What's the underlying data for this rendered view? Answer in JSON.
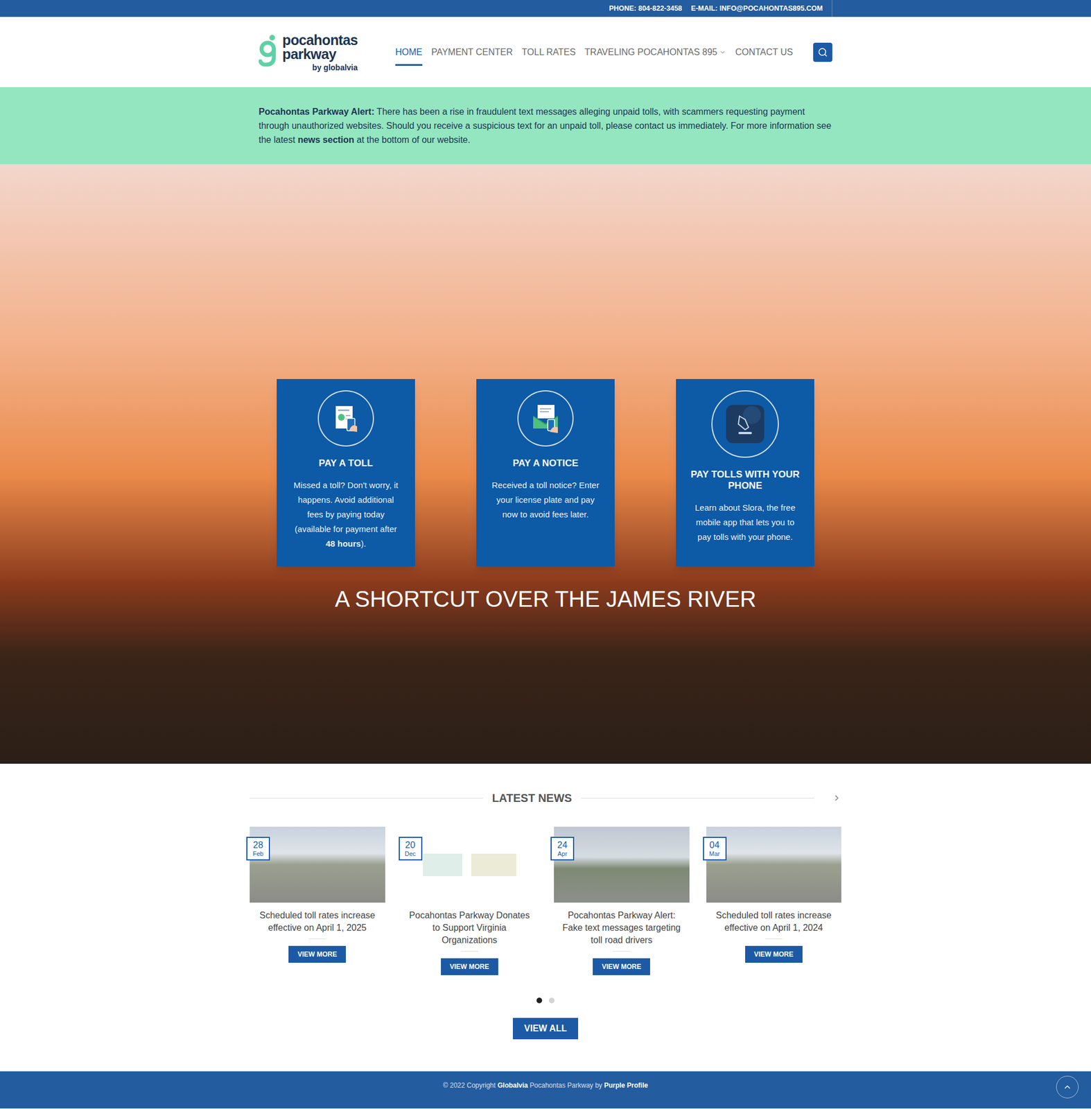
{
  "top_bar": {
    "phone": "PHONE: 804-822-3458",
    "email": "E-MAIL: INFO@POCAHONTAS895.COM"
  },
  "logo": {
    "line1": "pocahontas",
    "line2": "parkway",
    "line3": "by globalvia"
  },
  "nav": [
    {
      "label": "HOME",
      "selected": true,
      "dropdown": false
    },
    {
      "label": "PAYMENT CENTER",
      "selected": false,
      "dropdown": false
    },
    {
      "label": "TOLL RATES",
      "selected": false,
      "dropdown": false
    },
    {
      "label": "TRAVELING POCAHONTAS 895",
      "selected": false,
      "dropdown": true
    },
    {
      "label": "CONTACT US",
      "selected": false,
      "dropdown": false
    }
  ],
  "alert": {
    "label": "Pocahontas Parkway Alert:",
    "text": " There has been a rise in fraudulent text messages alleging unpaid tolls, with scammers requesting payment through unauthorized websites. Should you receive a suspicious text for an unpaid toll, please contact us immediately.  For more information see the latest ",
    "link": "news section",
    "after": " at the bottom of our website."
  },
  "hero": {
    "cards": [
      {
        "kind": "toll",
        "title": "PAY A TOLL",
        "description": [
          {
            "text": "Missed a toll? Don't worry, it happens. Avoid additional fees by paying today (available for payment after ",
            "bold": false
          },
          {
            "text": "48 hours",
            "bold": true
          },
          {
            "text": ").",
            "bold": false
          }
        ]
      },
      {
        "kind": "notice",
        "title": "PAY A NOTICE",
        "description": [
          {
            "text": "Received a toll notice? Enter your license plate and pay now to avoid fees later.",
            "bold": false
          }
        ]
      },
      {
        "kind": "phone",
        "title": "PAY TOLLS WITH YOUR PHONE",
        "description": [
          {
            "text": "Learn about Slora, the free mobile app that lets you to pay tolls with your phone.",
            "bold": false
          }
        ]
      }
    ],
    "headline": "A SHORTCUT OVER THE JAMES RIVER"
  },
  "news": {
    "heading": "LATEST NEWS",
    "items": [
      {
        "day": "28",
        "month": "Feb",
        "title": "Scheduled toll rates increase effective on April 1, 2025",
        "button": "VIEW MORE",
        "image": "road"
      },
      {
        "day": "20",
        "month": "Dec",
        "title": "Pocahontas Parkway Donates to Support Virginia Organizations",
        "button": "VIEW MORE",
        "image": "logos"
      },
      {
        "day": "24",
        "month": "Apr",
        "title": "Pocahontas Parkway Alert: Fake text messages targeting toll road drivers",
        "button": "VIEW MORE",
        "image": "bridge"
      },
      {
        "day": "04",
        "month": "Mar",
        "title": "Scheduled toll rates increase effective on April 1, 2024",
        "button": "VIEW MORE",
        "image": "road"
      }
    ],
    "dots": [
      {
        "selected": true
      },
      {
        "selected": false
      }
    ],
    "view_all": "VIEW ALL"
  },
  "footer": [
    {
      "text": "© 2022 Copyright ",
      "bold": false
    },
    {
      "text": "Globalvia",
      "bold": true
    },
    {
      "text": " Pocahontas Parkway by ",
      "bold": false
    },
    {
      "text": "Purple Profile",
      "bold": true
    }
  ]
}
